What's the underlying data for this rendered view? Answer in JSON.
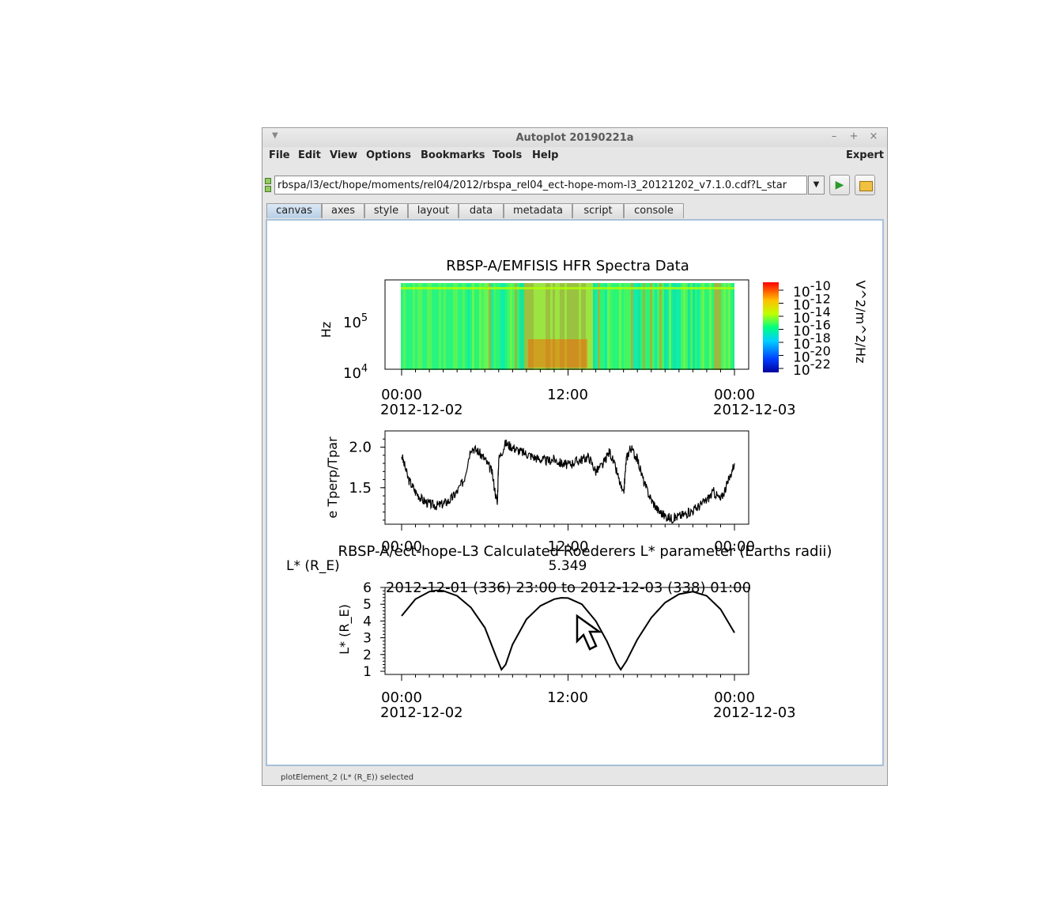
{
  "window": {
    "title": "Autoplot 20190221a",
    "controls": {
      "minimize": "–",
      "maximize": "+",
      "close": "×"
    }
  },
  "menubar": {
    "items": [
      "File",
      "Edit",
      "View",
      "Options",
      "Bookmarks",
      "Tools",
      "Help"
    ],
    "right": "Expert"
  },
  "address": {
    "value": "rbspa/l3/ect/hope/moments/rel04/2012/rbspa_rel04_ect-hope-mom-l3_20121202_v7.1.0.cdf?L_star"
  },
  "tabs": [
    {
      "label": "canvas",
      "active": true
    },
    {
      "label": "axes",
      "active": false
    },
    {
      "label": "style",
      "active": false
    },
    {
      "label": "layout",
      "active": false
    },
    {
      "label": "data",
      "active": false
    },
    {
      "label": "metadata",
      "active": false
    },
    {
      "label": "script",
      "active": false
    },
    {
      "label": "console",
      "active": false
    }
  ],
  "status": "plotElement_2 (L* (R_E)) selected",
  "chart_data": [
    {
      "type": "heatmap",
      "title": "RBSP-A/EMFISIS  HFR Spectra Data",
      "ylabel": "Hz",
      "ytick_labels": [
        "10^4",
        "10^5"
      ],
      "y_scale": "log",
      "colorbar_label": "V^2/m^2/Hz",
      "colorbar_ticks": [
        "10^-10",
        "10^-12",
        "10^-14",
        "10^-16",
        "10^-18",
        "10^-20",
        "10^-22"
      ],
      "x_ticks": [
        {
          "time": "00:00",
          "date": "2012-12-02"
        },
        {
          "time": "12:00",
          "date": ""
        },
        {
          "time": "00:00",
          "date": "2012-12-03"
        }
      ]
    },
    {
      "type": "line",
      "ylabel": "e Tperp/Tpar",
      "yticks": [
        1.5,
        2.0
      ],
      "ylim": [
        1.05,
        2.2
      ],
      "x_ticks": [
        "00:00",
        "12:00",
        "00:00"
      ],
      "x_hours": [
        0,
        0.5,
        1,
        1.5,
        2,
        2.5,
        3,
        3.5,
        4,
        4.5,
        5,
        5.5,
        6,
        6.5,
        6.9,
        7.0,
        7.5,
        8,
        8.5,
        9,
        9.5,
        10,
        10.5,
        11,
        11.5,
        12,
        12.5,
        13,
        13.5,
        14,
        14.5,
        15,
        15.5,
        16,
        16.2,
        16.5,
        17,
        17.5,
        18,
        18.5,
        19,
        19.5,
        20,
        20.5,
        21,
        21.5,
        22,
        22.5,
        23,
        23.5,
        24
      ],
      "values": [
        1.9,
        1.6,
        1.45,
        1.35,
        1.3,
        1.28,
        1.3,
        1.35,
        1.45,
        1.6,
        2.0,
        1.95,
        1.85,
        1.7,
        1.3,
        1.85,
        2.05,
        2.0,
        1.95,
        1.92,
        1.88,
        1.85,
        1.83,
        1.85,
        1.8,
        1.78,
        1.82,
        1.85,
        1.88,
        1.7,
        1.78,
        1.95,
        1.7,
        1.4,
        1.85,
        2.0,
        1.85,
        1.55,
        1.35,
        1.22,
        1.15,
        1.12,
        1.15,
        1.18,
        1.22,
        1.28,
        1.35,
        1.45,
        1.35,
        1.55,
        1.8
      ],
      "crosshair": {
        "time": "12:00",
        "value": "5.349"
      }
    },
    {
      "type": "line",
      "title": "RBSP-A/ect-hope-L3  Calculated Roederers L* parameter (Earths radii)",
      "ylabel": "L* (R_E)",
      "yticks": [
        1,
        2,
        3,
        4,
        5,
        6
      ],
      "ylim": [
        1,
        6
      ],
      "time_range": "2012-12-01 (336) 23:00 to 2012-12-03 (338) 01:00",
      "readout_label": "L* (R_E)",
      "readout_value": "5.349",
      "x_ticks": [
        {
          "time": "00:00",
          "date": "2012-12-02"
        },
        {
          "time": "12:00",
          "date": ""
        },
        {
          "time": "00:00",
          "date": "2012-12-03"
        }
      ],
      "x_hours": [
        0,
        1,
        2,
        2.5,
        3,
        4,
        5,
        6,
        6.8,
        7.2,
        7.5,
        8,
        9,
        10,
        11,
        11.5,
        12,
        13,
        14,
        14.8,
        15.5,
        15.8,
        16.2,
        17,
        18,
        19,
        20,
        21,
        22,
        23,
        24
      ],
      "values": [
        4.3,
        5.3,
        5.75,
        5.82,
        5.8,
        5.5,
        4.8,
        3.6,
        1.9,
        1.1,
        1.4,
        2.6,
        4.1,
        4.9,
        5.3,
        5.38,
        5.37,
        5.0,
        4.0,
        2.8,
        1.5,
        1.1,
        1.6,
        2.9,
        4.2,
        5.1,
        5.6,
        5.75,
        5.5,
        4.7,
        3.3
      ]
    }
  ]
}
